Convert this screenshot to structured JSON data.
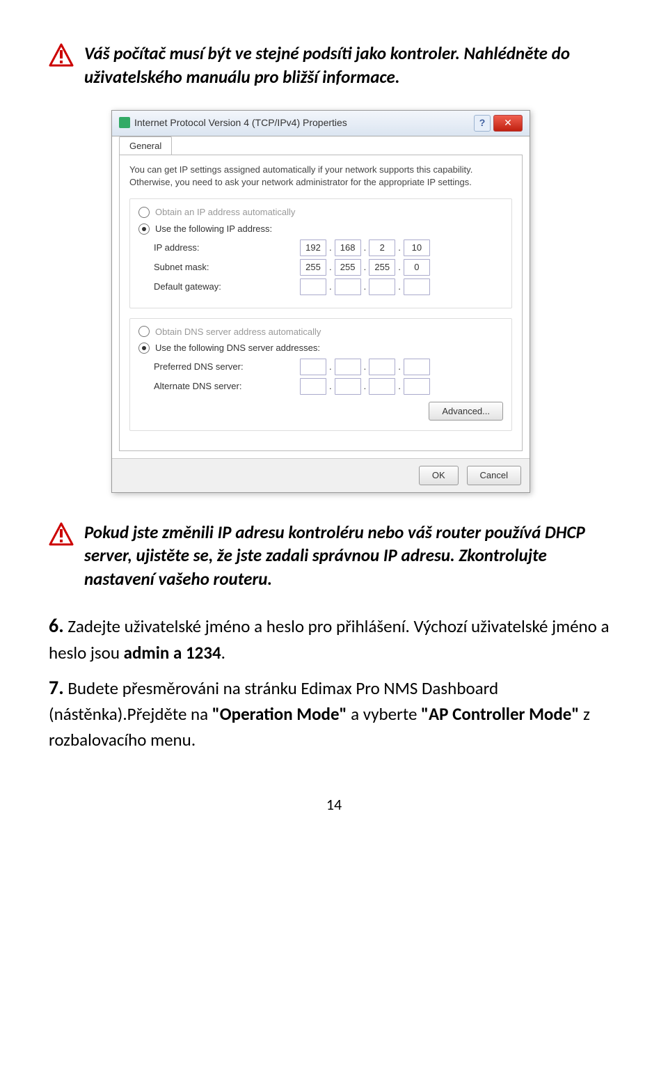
{
  "warn1": "Váš počítač musí být ve stejné podsíti jako kontroler. Nahlédněte do uživatelského manuálu pro bližší informace.",
  "warn2": "Pokud jste změnili IP adresu kontroléru nebo váš router používá DHCP server, ujistěte se, že jste zadali správnou IP adresu. Zkontrolujte nastavení vašeho routeru.",
  "dialog": {
    "title": "Internet Protocol Version 4 (TCP/IPv4) Properties",
    "help": "?",
    "close": "✕",
    "tab": "General",
    "desc": "You can get IP settings assigned automatically if your network supports this capability. Otherwise, you need to ask your network administrator for the appropriate IP settings.",
    "radio_auto": "Obtain an IP address automatically",
    "radio_use": "Use the following IP address:",
    "lbl_ip": "IP address:",
    "ip": [
      "192",
      "168",
      "2",
      "10"
    ],
    "lbl_subnet": "Subnet mask:",
    "subnet": [
      "255",
      "255",
      "255",
      "0"
    ],
    "lbl_gateway": "Default gateway:",
    "gateway": [
      "",
      "",
      "",
      ""
    ],
    "radio_dns_auto": "Obtain DNS server address automatically",
    "radio_dns_use": "Use the following DNS server addresses:",
    "lbl_preferred": "Preferred DNS server:",
    "preferred": [
      "",
      "",
      "",
      ""
    ],
    "lbl_alternate": "Alternate DNS server:",
    "alternate": [
      "",
      "",
      "",
      ""
    ],
    "advanced": "Advanced...",
    "ok": "OK",
    "cancel": "Cancel"
  },
  "step6_num": "6.",
  "step6_a": " Zadejte uživatelské jméno a heslo pro přihlášení. Výchozí uživatelské jméno a heslo jsou ",
  "step6_b": "admin a 1234",
  "step7_num": "7.",
  "step7_a": " Budete přesměrováni na stránku Edimax Pro NMS Dashboard (nástěnka).Přejděte na ",
  "step7_b": "\"Operation Mode\"",
  "step7_c": " a vyberte ",
  "step7_d": "\"AP Controller Mode\"",
  "step7_e": " z rozbalovacího menu.",
  "page": "14"
}
